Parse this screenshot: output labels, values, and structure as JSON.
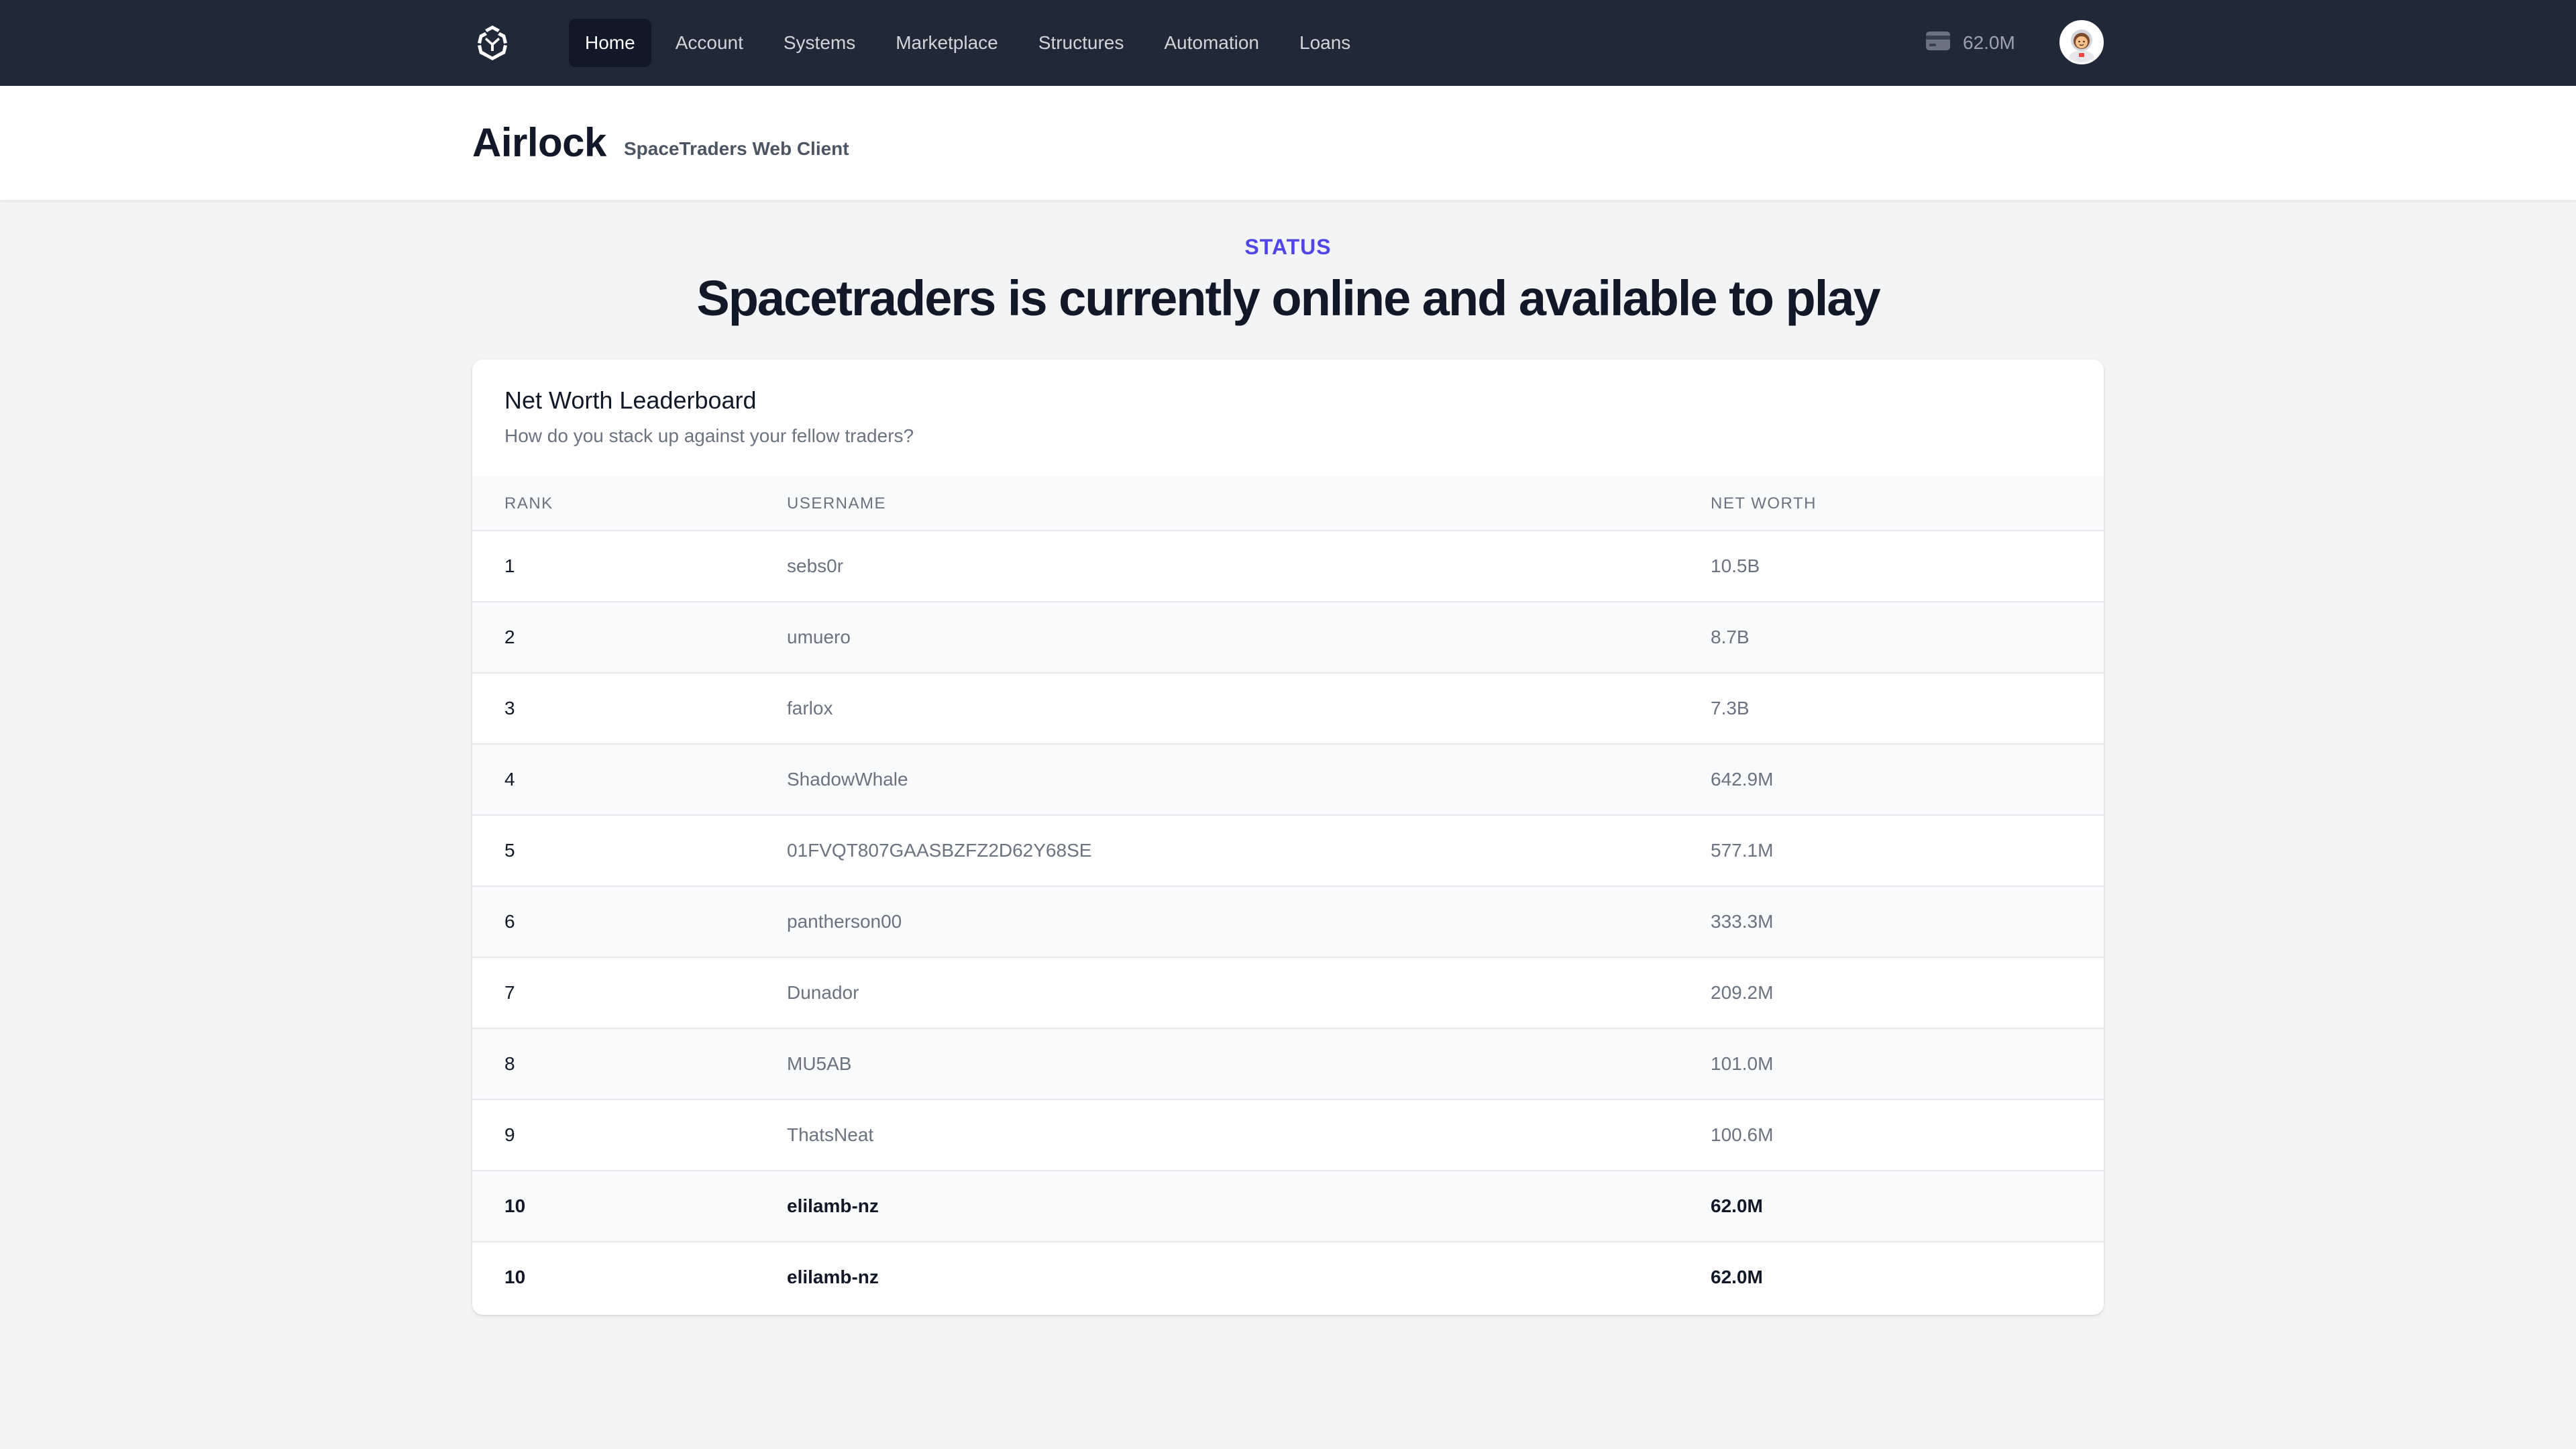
{
  "nav": {
    "items": [
      {
        "label": "Home",
        "active": true
      },
      {
        "label": "Account",
        "active": false
      },
      {
        "label": "Systems",
        "active": false
      },
      {
        "label": "Marketplace",
        "active": false
      },
      {
        "label": "Structures",
        "active": false
      },
      {
        "label": "Automation",
        "active": false
      },
      {
        "label": "Loans",
        "active": false
      }
    ],
    "credits": "62.0M",
    "credits_icon": "credit-card-icon",
    "avatar_icon": "astronaut-avatar"
  },
  "header": {
    "title": "Airlock",
    "subtitle": "SpaceTraders Web Client"
  },
  "status": {
    "label": "STATUS",
    "heading": "Spacetraders is currently online and available to play"
  },
  "leaderboard": {
    "title": "Net Worth Leaderboard",
    "description": "How do you stack up against your fellow traders?",
    "columns": [
      "RANK",
      "USERNAME",
      "NET WORTH"
    ],
    "rows": [
      {
        "rank": "1",
        "username": "sebs0r",
        "net_worth": "10.5B",
        "self": false
      },
      {
        "rank": "2",
        "username": "umuero",
        "net_worth": "8.7B",
        "self": false
      },
      {
        "rank": "3",
        "username": "farlox",
        "net_worth": "7.3B",
        "self": false
      },
      {
        "rank": "4",
        "username": "ShadowWhale",
        "net_worth": "642.9M",
        "self": false
      },
      {
        "rank": "5",
        "username": "01FVQT807GAASBZFZ2D62Y68SE",
        "net_worth": "577.1M",
        "self": false
      },
      {
        "rank": "6",
        "username": "pantherson00",
        "net_worth": "333.3M",
        "self": false
      },
      {
        "rank": "7",
        "username": "Dunador",
        "net_worth": "209.2M",
        "self": false
      },
      {
        "rank": "8",
        "username": "MU5AB",
        "net_worth": "101.0M",
        "self": false
      },
      {
        "rank": "9",
        "username": "ThatsNeat",
        "net_worth": "100.6M",
        "self": false
      },
      {
        "rank": "10",
        "username": "elilamb-nz",
        "net_worth": "62.0M",
        "self": true
      },
      {
        "rank": "10",
        "username": "elilamb-nz",
        "net_worth": "62.0M",
        "self": true
      }
    ]
  },
  "colors": {
    "nav_bg": "#1f2937",
    "accent": "#4f46e5",
    "page_bg": "#f3f4f6"
  }
}
